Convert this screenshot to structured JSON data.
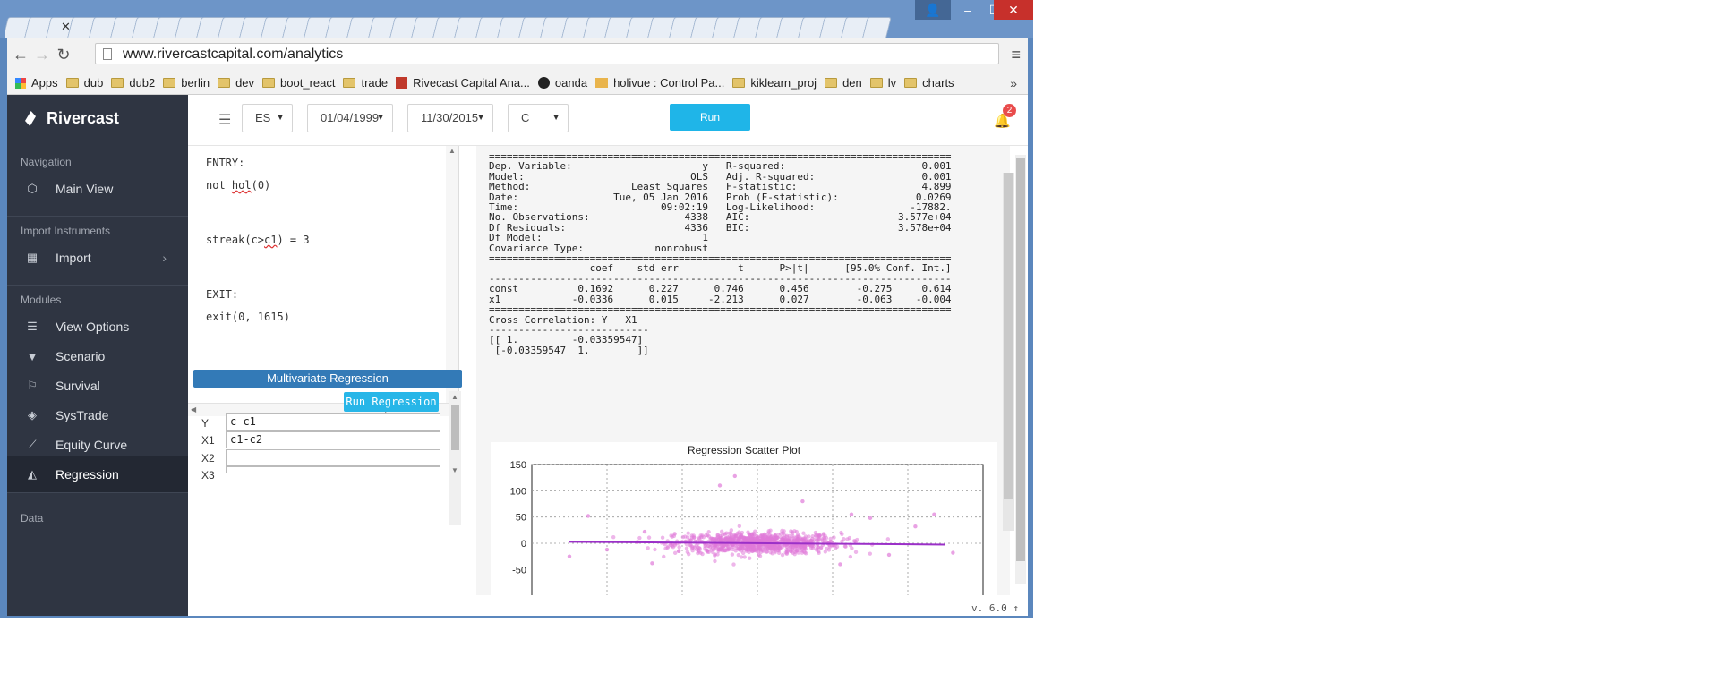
{
  "browser": {
    "url": "www.rivercastcapital.com/analytics",
    "bookmarks": [
      "Apps",
      "dub",
      "dub2",
      "berlin",
      "dev",
      "boot_react",
      "trade",
      "Rivecast Capital Ana...",
      "oanda",
      "holivue : Control Pa...",
      "kiklearn_proj",
      "den",
      "lv",
      "charts"
    ],
    "more": "»"
  },
  "sidebar": {
    "brand": "Rivercast",
    "sections": {
      "navigation": "Navigation",
      "import": "Import Instruments",
      "modules": "Modules",
      "data": "Data"
    },
    "items": {
      "main_view": "Main View",
      "import": "Import",
      "view_options": "View Options",
      "scenario": "Scenario",
      "survival": "Survival",
      "systrade": "SysTrade",
      "equity_curve": "Equity Curve",
      "regression": "Regression"
    }
  },
  "header": {
    "instrument": "ES",
    "start_date": "01/04/1999",
    "end_date": "11/30/2015",
    "field": "C",
    "run": "Run",
    "notifications": "2"
  },
  "editor": {
    "entry_label": "ENTRY:",
    "line1_a": "not ",
    "line1_b": "hol",
    "line1_c": "(0)",
    "line2_a": "streak(c>",
    "line2_b": "c1",
    "line2_c": ") = 3",
    "exit_label": "EXIT:",
    "line3": "exit(0, 1615)"
  },
  "regression_panel": {
    "title": "Multivariate Regression",
    "run": "Run Regression",
    "fields": [
      {
        "label": "Y",
        "value": "c-c1"
      },
      {
        "label": "X1",
        "value": "c1-c2"
      },
      {
        "label": "X2",
        "value": ""
      },
      {
        "label": "X3",
        "value": ""
      }
    ]
  },
  "results": {
    "text": "==============================================================================\nDep. Variable:                      y   R-squared:                       0.001\nModel:                            OLS   Adj. R-squared:                  0.001\nMethod:                 Least Squares   F-statistic:                     4.899\nDate:                Tue, 05 Jan 2016   Prob (F-statistic):             0.0269\nTime:                        09:02:19   Log-Likelihood:                -17882.\nNo. Observations:                4338   AIC:                         3.577e+04\nDf Residuals:                    4336   BIC:                         3.578e+04\nDf Model:                           1\nCovariance Type:            nonrobust\n==============================================================================\n                 coef    std err          t      P>|t|      [95.0% Conf. Int.]\n------------------------------------------------------------------------------\nconst          0.1692      0.227      0.746      0.456        -0.275     0.614\nx1            -0.0336      0.015     -2.213      0.027        -0.063    -0.004\n==============================================================================\nCross Correlation: Y   X1\n---------------------------\n[[ 1.         -0.03359547]\n [-0.03359547  1.        ]]"
  },
  "chart_data": {
    "type": "scatter",
    "title": "Regression Scatter Plot",
    "y_ticks": [
      "150",
      "100",
      "50",
      "0",
      "-50"
    ],
    "ylim": [
      -50,
      150
    ],
    "xlim": [
      -60,
      60
    ],
    "grid": true,
    "point_color": "#e07ad8",
    "line_color": "#9b30c8",
    "regression_line": {
      "intercept": 0.1692,
      "slope": -0.0336
    },
    "cloud": {
      "center_x": 0,
      "center_y": 0,
      "sigma_x": 11,
      "sigma_y": 10,
      "count": 900
    },
    "outliers": [
      {
        "x": -22,
        "y": 18
      },
      {
        "x": -30,
        "y": 22
      },
      {
        "x": -45,
        "y": 52
      },
      {
        "x": -10,
        "y": 110
      },
      {
        "x": -6,
        "y": 128
      },
      {
        "x": 12,
        "y": 80
      },
      {
        "x": 25,
        "y": 55
      },
      {
        "x": 30,
        "y": 48
      },
      {
        "x": 42,
        "y": 32
      },
      {
        "x": 47,
        "y": 55
      },
      {
        "x": -50,
        "y": -25
      },
      {
        "x": 52,
        "y": -18
      },
      {
        "x": 22,
        "y": -40
      },
      {
        "x": -28,
        "y": -38
      },
      {
        "x": 35,
        "y": -22
      },
      {
        "x": -40,
        "y": -12
      }
    ]
  },
  "footer": {
    "version": "v. 6.0",
    "arrow": "↑"
  }
}
